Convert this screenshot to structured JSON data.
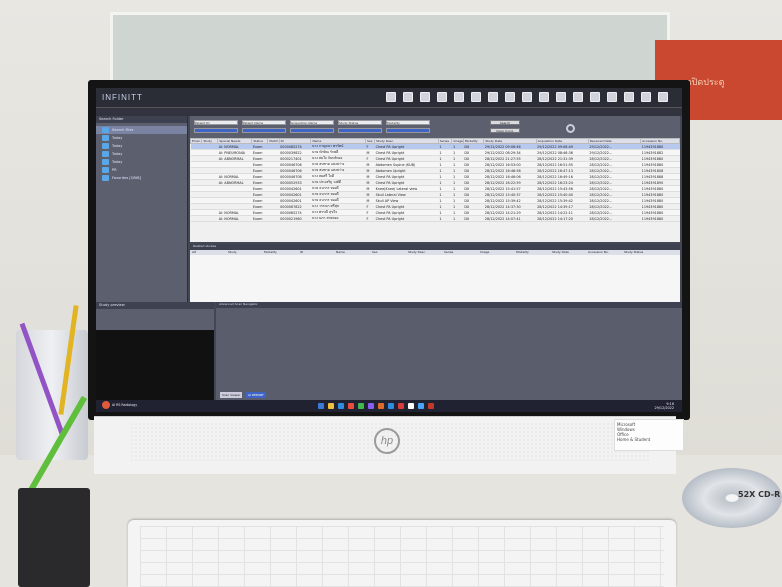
{
  "app": {
    "logo": "INFINITT",
    "left_pane_title": "Search Folder",
    "tree": [
      {
        "label": "Search Files",
        "selected": true
      },
      {
        "label": "Today",
        "selected": false
      },
      {
        "label": "Today",
        "selected": false
      },
      {
        "label": "Today",
        "selected": false
      },
      {
        "label": "Today",
        "selected": false
      },
      {
        "label": "PR",
        "selected": false
      },
      {
        "label": "Favorites [GRIB]",
        "selected": false
      }
    ],
    "search_filters": [
      "Patient ID",
      "Patient Name",
      "Acquisition Name",
      "Study Status",
      "Modality"
    ],
    "search_button": "Search",
    "clear_button": "Clear Cond.",
    "columns": [
      "Emer.",
      "Study",
      "Special Needs",
      "Status",
      "Match",
      "ID",
      "Name",
      "Sex",
      "Study Desc.",
      "Series",
      "Image",
      "Modality",
      "Study Date",
      "Acquisition Date",
      "Received Date",
      "Accession No."
    ],
    "rows": [
      [
        "AI: NORMAL",
        "Exam",
        "0000085274",
        "นาง กาญจนา พรรัตน์",
        "F",
        "Chest PA Upright",
        "1",
        "1",
        "DX",
        "29/12/2022 09:06:46",
        "29/12/2022 09:08:49",
        "29/12/2022...",
        "1194391880"
      ],
      [
        "AI: PNEUMONIA",
        "Exam",
        "0000039822",
        "นาย ทักษิณ รักษดี",
        "M",
        "Chest PA Upright",
        "1",
        "1",
        "DX",
        "29/12/2022 08:29:34",
        "29/12/2022 08:46:36",
        "29/12/2022...",
        "1194391882"
      ],
      [
        "AI: ABNORMAL",
        "Exam",
        "0000217401",
        "นาง สมใจ จันทร์ทอง",
        "F",
        "Chest PA Upright",
        "1",
        "1",
        "DX",
        "28/12/2022 21:27:55",
        "28/12/2022 21:31:39",
        "28/12/2022...",
        "1194391880"
      ],
      [
        "",
        "Exam",
        "0000046706",
        "นาย สมชาย แสงสว่าง",
        "M",
        "Abdomen Supine (KUB)",
        "1",
        "1",
        "DX",
        "28/12/2022 16:53:00",
        "28/12/2022 16:51:55",
        "28/12/2022...",
        "1194391880"
      ],
      [
        "",
        "Exam",
        "0000046706",
        "นาย สมชาย แสงสว่าง",
        "M",
        "Abdomen Upright",
        "1",
        "1",
        "DX",
        "28/12/2022 16:46:58",
        "28/12/2022 16:47:13",
        "28/12/2022...",
        "1194391808"
      ],
      [
        "AI: NORMAL",
        "Exam",
        "0000046708",
        "นาง สมศรี ใจดี",
        "M",
        "Chest PA Upright",
        "1",
        "1",
        "DX",
        "28/12/2022 16:46:06",
        "28/12/2022 16:49:16",
        "28/12/2022...",
        "1194391888"
      ],
      [
        "AI: ABNORMAL",
        "Exam",
        "0000052933",
        "นาย ประเสริฐ วงศ์ดี",
        "M",
        "Chest PA Upright",
        "1",
        "1",
        "DX",
        "28/12/2022 16:22:59",
        "28/12/2022 16:23:24",
        "28/12/2022...",
        "1194391890"
      ],
      [
        "",
        "Exam",
        "0000042601",
        "นาย ธนากร ทองดี",
        "M",
        "Knee(Knee) Lateral view",
        "1",
        "1",
        "DX",
        "28/12/2022 15:41:57",
        "28/12/2022 15:43:56",
        "28/12/2022...",
        "1194391880"
      ],
      [
        "",
        "Exam",
        "0000042601",
        "นาย ธนากร ทองดี",
        "M",
        "Skull Lateral View",
        "1",
        "1",
        "DX",
        "28/12/2022 15:40:37",
        "28/12/2022 15:40:40",
        "28/12/2022...",
        "1194391880"
      ],
      [
        "",
        "Exam",
        "0000042601",
        "นาย ธนากร ทองดี",
        "M",
        "Skull AP View",
        "1",
        "1",
        "DX",
        "28/12/2022 15:39:42",
        "28/12/2022 15:39:42",
        "28/12/2022...",
        "1194391880"
      ],
      [
        "",
        "Exam",
        "0000067822",
        "นาง วรรณา ศรีสุข",
        "F",
        "Chest PA Upright",
        "1",
        "1",
        "DX",
        "28/12/2022 14:37:30",
        "28/12/2022 14:39:17",
        "28/12/2022...",
        "1194391880"
      ],
      [
        "AI: NORMAL",
        "Exam",
        "0000085274",
        "นาง พรรณี สุขใจ",
        "F",
        "Chest PA Upright",
        "1",
        "1",
        "DX",
        "28/12/2022 14:21:29",
        "28/12/2022 14:22:11",
        "28/12/2022...",
        "1194391880"
      ],
      [
        "AI: NORMAL",
        "Exam",
        "0000021960",
        "นาง นภา สายทอง",
        "F",
        "Chest PA Upright",
        "1",
        "1",
        "DX",
        "28/12/2022 14:07:41",
        "28/12/2022 14:17:20",
        "28/12/2022...",
        "1194391880"
      ]
    ],
    "lower_title": "Related studies",
    "lower_columns": [
      "Alt",
      "Study",
      "Modality",
      "ID",
      "Name",
      "Sex",
      "Study Desc.",
      "Series",
      "Image",
      "Modality",
      "Study Date",
      "Accession No.",
      "Study Status"
    ],
    "bottom_left_title": "Study preview",
    "bottom_right_title": "Advanced Scan Navigator",
    "bottom_tabs": [
      "Scan Viewer",
      "AI REPORT"
    ],
    "taskbar_app": "AI RS Radiology",
    "clock_time": "9:16",
    "clock_date": "29/12/2022"
  },
  "desk": {
    "poster_text": "กรุณาปิดประตู",
    "sticker_lines": [
      "Microsoft",
      "Windows",
      "Office",
      "Home & Student"
    ],
    "cd_label": "52X CD-R"
  }
}
